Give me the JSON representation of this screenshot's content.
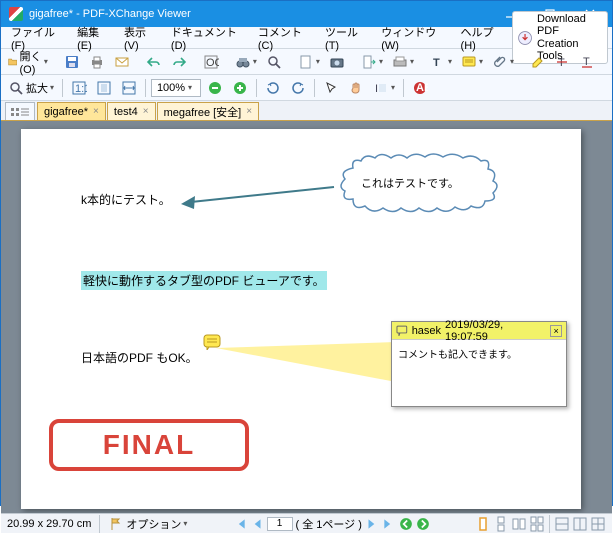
{
  "titlebar": {
    "title": "gigafree* - PDF-XChange Viewer"
  },
  "menu": {
    "items": [
      "ファイル(F)",
      "編集(E)",
      "表示(V)",
      "ドキュメント(D)",
      "コメント(C)",
      "ツール(T)",
      "ウィンドウ(W)",
      "ヘルプ(H)"
    ],
    "download": {
      "line1": "Download PDF",
      "line2": "Creation Tools"
    }
  },
  "toolbar1": {
    "open": "開く(O)",
    "triangle": "▾"
  },
  "toolbar2": {
    "zoom": "拡大",
    "zoomValue": "100%",
    "triangle": "▾"
  },
  "tabs": {
    "items": [
      {
        "label": "gigafree*",
        "active": true
      },
      {
        "label": "test4",
        "active": false
      },
      {
        "label": "megafree [安全]",
        "active": false
      }
    ]
  },
  "doc": {
    "cloudText": "これはテストです。",
    "text1": "k本的にテスト。",
    "highlight": "軽快に動作するタブ型のPDF ビューアです。",
    "text3": "日本語のPDF もOK。",
    "stamp": "FINAL"
  },
  "popup": {
    "author": "hasek",
    "date": "2019/03/29, 19:07:59",
    "body": "コメントも記入できます。",
    "close": "×"
  },
  "status": {
    "dims": "20.99 x 29.70 cm",
    "options": "オプション",
    "page": "1",
    "total": "( 全 1ページ )",
    "triangle": "▾"
  },
  "colors": {
    "accent": "#1a8fe3",
    "cloud": "#5b8bb5",
    "arrow": "#3f7a8a",
    "highlight": "#a0e8ea",
    "noteYellow": "#ffe850",
    "stampRed": "#d9443a",
    "popupHeader": "#f2f268"
  }
}
